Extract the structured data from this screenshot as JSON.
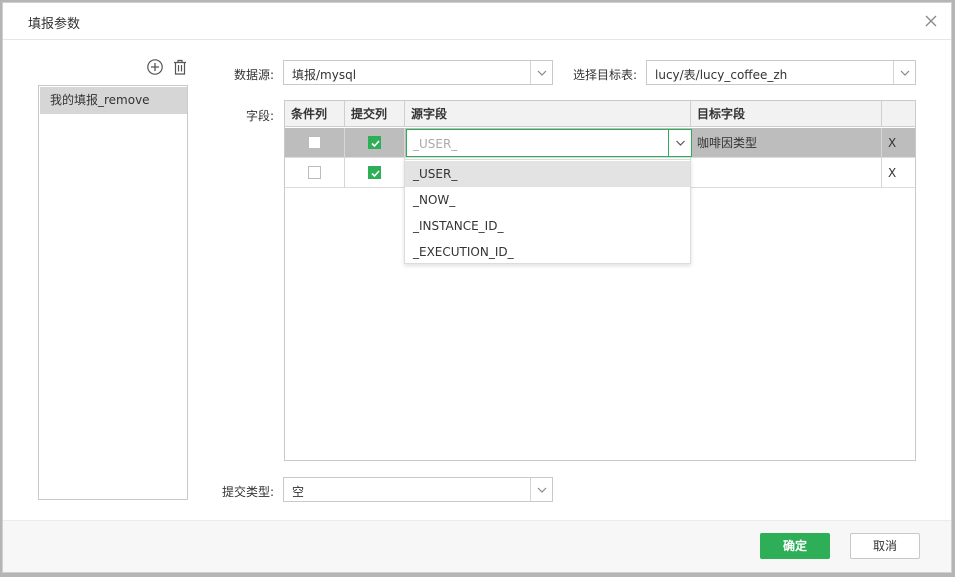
{
  "dialog": {
    "title": "填报参数"
  },
  "left_panel": {
    "items": [
      {
        "label": "我的填报_remove"
      }
    ]
  },
  "form": {
    "datasource_label": "数据源:",
    "datasource_value": "填报/mysql",
    "target_table_label": "选择目标表:",
    "target_table_value": "lucy/表/lucy_coffee_zh",
    "fields_label": "字段:",
    "submit_type_label": "提交类型:",
    "submit_type_value": "空"
  },
  "table": {
    "headers": [
      "条件列",
      "提交列",
      "源字段",
      "目标字段",
      ""
    ],
    "rows": [
      {
        "condition": false,
        "submit": true,
        "source": "_USER_",
        "target": "咖啡因类型",
        "delete": "X",
        "selected": true
      },
      {
        "condition": false,
        "submit": true,
        "source": "",
        "target": "",
        "delete": "X",
        "selected": false
      }
    ]
  },
  "dropdown": {
    "options": [
      "_USER_",
      "_NOW_",
      "_INSTANCE_ID_",
      "_EXECUTION_ID_"
    ],
    "highlighted_index": 0
  },
  "footer": {
    "ok_label": "确定",
    "cancel_label": "取消"
  },
  "colors": {
    "accent": "#2dae57",
    "selected_row": "#bdbdbd"
  },
  "icons": [
    "close-icon",
    "add-circle-icon",
    "trash-icon",
    "chevron-down-icon",
    "checkmark-icon"
  ]
}
